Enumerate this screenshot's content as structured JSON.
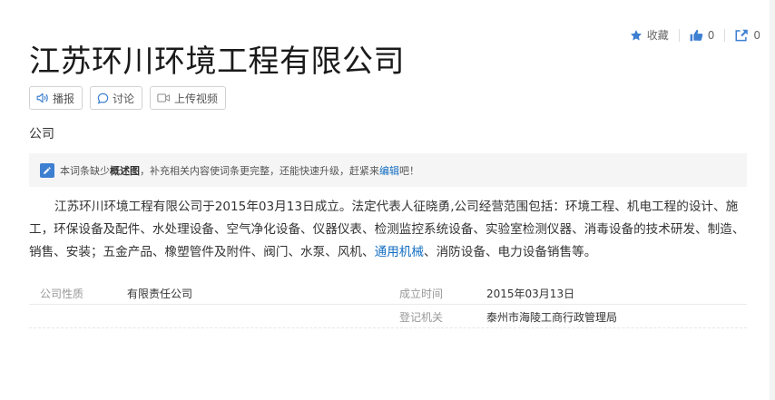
{
  "actions": {
    "favorite_label": "收藏",
    "like_count": "0",
    "share_count": "0"
  },
  "title": "江苏环川环境工程有限公司",
  "toolbar": {
    "broadcast_label": "播报",
    "discuss_label": "讨论",
    "upload_video_label": "上传视频"
  },
  "category": "公司",
  "notice": {
    "prefix": "本词条缺少",
    "missing": "概述图",
    "middle": "，补充相关内容使词条更完整，还能快速升级，赶紧来",
    "link": "编辑",
    "suffix": "吧！"
  },
  "summary": {
    "text_before_link": "江苏环川环境工程有限公司于2015年03月13日成立。法定代表人征晓勇,公司经营范围包括：环境工程、机电工程的设计、施工，环保设备及配件、水处理设备、空气净化设备、仪器仪表、检测监控系统设备、实验室检测仪器、消毒设备的技术研发、制造、销售、安装；五金产品、橡塑管件及附件、阀门、水泵、风机、",
    "link": "通用机械",
    "text_after_link": "、消防设备、电力设备销售等。"
  },
  "basic_info": {
    "rows": [
      [
        {
          "name": "公司性质",
          "value": "有限责任公司"
        },
        {
          "name": "成立时间",
          "value": "2015年03月13日"
        }
      ],
      [
        {
          "name": "",
          "value": ""
        },
        {
          "name": "登记机关",
          "value": "泰州市海陵工商行政管理局"
        }
      ]
    ]
  },
  "colors": {
    "accent": "#136ec2",
    "icon_blue": "#3d7fd1",
    "notice_bg": "#f5f5f5"
  },
  "icons": [
    "star-icon",
    "thumbs-up-icon",
    "share-icon",
    "speaker-icon",
    "chat-bubble-icon",
    "video-icon",
    "pencil-icon"
  ]
}
